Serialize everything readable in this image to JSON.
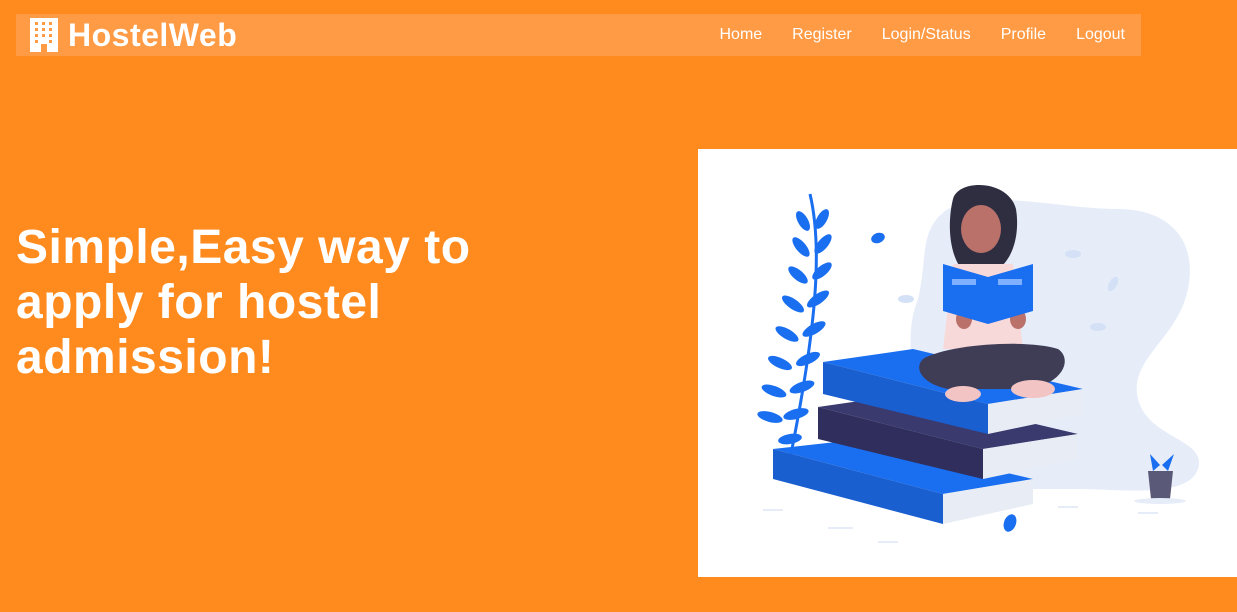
{
  "brand": {
    "name": "HostelWeb",
    "icon": "building-icon"
  },
  "nav": {
    "items": [
      {
        "label": "Home"
      },
      {
        "label": "Register"
      },
      {
        "label": "Login/Status"
      },
      {
        "label": "Profile"
      },
      {
        "label": "Logout"
      }
    ]
  },
  "hero": {
    "line1": "Simple,Easy way to",
    "line2": "apply for hostel",
    "line3": "admission!",
    "illustration": "woman-reading-on-books-illustration"
  },
  "colors": {
    "background": "#ff8a1e",
    "navbar": "#ff9a45",
    "accent_blue": "#1a6ef0",
    "dark_navy": "#2f2e5c"
  }
}
